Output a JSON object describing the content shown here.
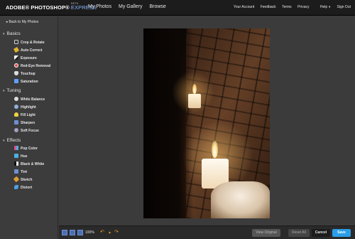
{
  "header": {
    "brand_main": "ADOBE® PHOTOSHOP®",
    "brand_express": "EXPRESS",
    "brand_beta": "BETA",
    "nav": [
      "My Photos",
      "My Gallery",
      "Browse"
    ],
    "links": [
      "Your Account",
      "Feedback",
      "Terms",
      "Privacy",
      "Help",
      "Sign Out"
    ]
  },
  "sidebar": {
    "back_label": "Back to My Photos",
    "sections": [
      {
        "title": "Basics",
        "tools": [
          {
            "label": "Crop & Rotate",
            "icon": "crop-icon",
            "color": "#d8d8d8"
          },
          {
            "label": "Auto Correct",
            "icon": "wand-icon",
            "color": "#e0b030"
          },
          {
            "label": "Exposure",
            "icon": "exposure-icon",
            "color": "#cccccc"
          },
          {
            "label": "Red-Eye Removal",
            "icon": "eye-icon",
            "color": "#e05050"
          },
          {
            "label": "Touchup",
            "icon": "hand-icon",
            "color": "#dddddd"
          },
          {
            "label": "Saturation",
            "icon": "saturation-icon",
            "color": "#5fa0ff"
          }
        ]
      },
      {
        "title": "Tuning",
        "tools": [
          {
            "label": "White Balance",
            "icon": "white-balance-icon",
            "color": "#dddddd"
          },
          {
            "label": "Highlight",
            "icon": "highlight-icon",
            "color": "#8fb0e0"
          },
          {
            "label": "Fill Light",
            "icon": "bulb-icon",
            "color": "#f0d040"
          },
          {
            "label": "Sharpen",
            "icon": "sharpen-icon",
            "color": "#6f8fd0"
          },
          {
            "label": "Soft Focus",
            "icon": "soft-focus-icon",
            "color": "#a0a0c0"
          }
        ]
      },
      {
        "title": "Effects",
        "tools": [
          {
            "label": "Pop Color",
            "icon": "pop-color-icon",
            "color": "#e05090"
          },
          {
            "label": "Hue",
            "icon": "hue-icon",
            "color": "#50b0e0"
          },
          {
            "label": "Black & White",
            "icon": "bw-icon",
            "color": "#bbbbbb"
          },
          {
            "label": "Tint",
            "icon": "tint-icon",
            "color": "#6f8fd0"
          },
          {
            "label": "Sketch",
            "icon": "sketch-icon",
            "color": "#e0a030"
          },
          {
            "label": "Distort",
            "icon": "distort-icon",
            "color": "#50a0e0"
          }
        ]
      }
    ]
  },
  "toolbar": {
    "zoom": "100%",
    "view_original": "View Original",
    "reset_all": "Reset All",
    "cancel": "Cancel",
    "save": "Save"
  }
}
